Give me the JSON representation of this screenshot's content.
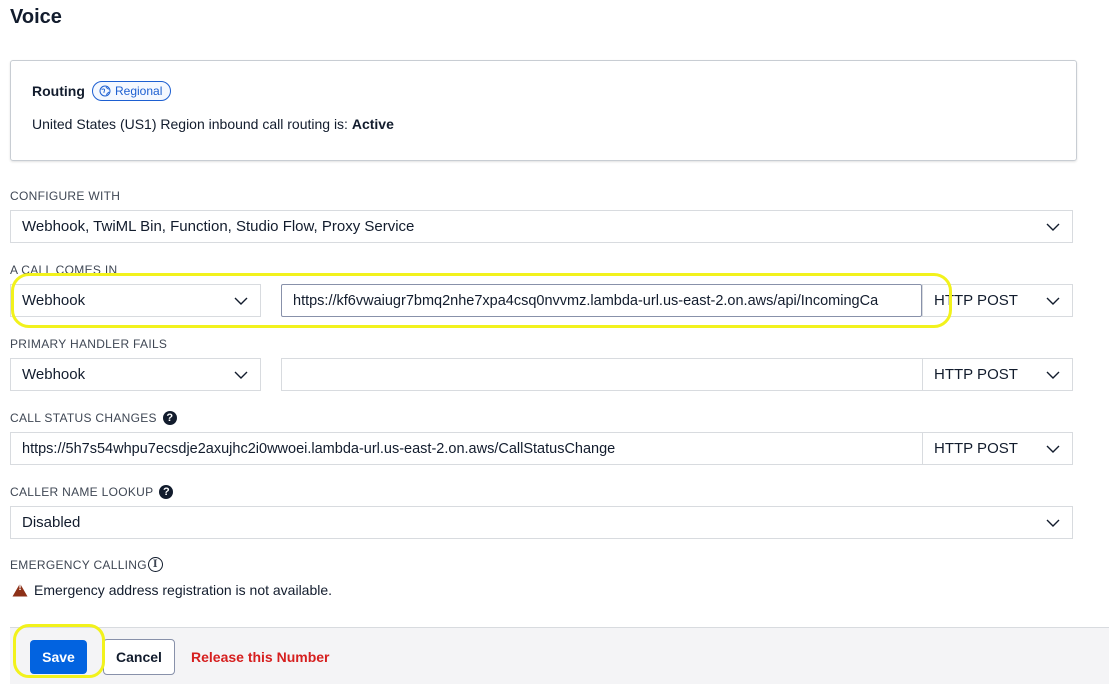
{
  "page": {
    "title": "Voice"
  },
  "routing": {
    "label": "Routing",
    "badge": "Regional",
    "status_prefix": "United States (US1) Region inbound call routing is:",
    "status_value": "Active"
  },
  "configure_with": {
    "label": "CONFIGURE WITH",
    "value": "Webhook, TwiML Bin, Function, Studio Flow, Proxy Service"
  },
  "call_comes_in": {
    "label": "A CALL COMES IN",
    "type": "Webhook",
    "url": "https://kf6vwaiugr7bmq2nhe7xpa4csq0nvvmz.lambda-url.us-east-2.on.aws/api/IncomingCa",
    "method": "HTTP POST"
  },
  "primary_handler_fails": {
    "label": "PRIMARY HANDLER FAILS",
    "type": "Webhook",
    "url": "",
    "method": "HTTP POST"
  },
  "call_status_changes": {
    "label": "CALL STATUS CHANGES",
    "url": "https://5h7s54whpu7ecsdje2axujhc2i0wwoei.lambda-url.us-east-2.on.aws/CallStatusChange",
    "method": "HTTP POST",
    "help_glyph": "?"
  },
  "caller_name_lookup": {
    "label": "CALLER NAME LOOKUP",
    "value": "Disabled",
    "help_glyph": "?"
  },
  "emergency_calling": {
    "label": "EMERGENCY CALLING",
    "info_glyph": "i",
    "warning_glyph": "!",
    "message": "Emergency address registration is not available."
  },
  "footer": {
    "save_label": "Save",
    "cancel_label": "Cancel",
    "release_label": "Release this Number"
  },
  "colors": {
    "primary": "#0263e0",
    "destructive": "#d61f1f",
    "warning": "#8d3118",
    "highlight": "#f2f21c",
    "badge": "#1d5fd1"
  }
}
